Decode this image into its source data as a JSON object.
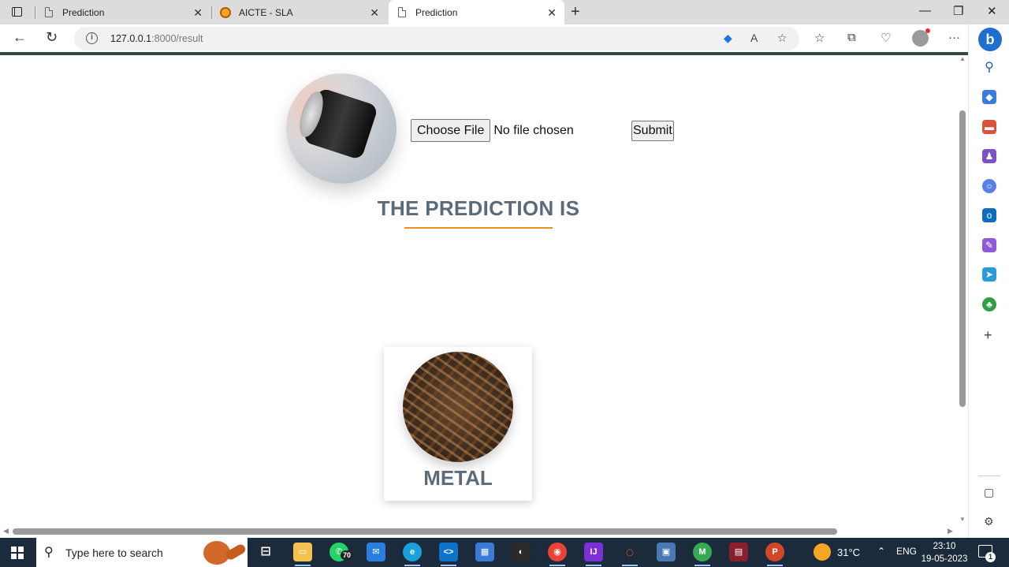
{
  "browser": {
    "tabs": [
      {
        "title": "Prediction"
      },
      {
        "title": "AICTE - SLA"
      },
      {
        "title": "Prediction"
      }
    ],
    "url_host": "127.0.0.1",
    "url_rest": ":8000/result"
  },
  "page": {
    "file_button_label": "Choose File",
    "file_status": "No file chosen",
    "submit_label": "Submit",
    "heading": "THE PREDICTION IS",
    "prediction_label": "METAL"
  },
  "colors": {
    "heading_text": "#5b6b7a",
    "heading_underline": "#f08c22",
    "divider": "#2e4a44",
    "taskbar": "#1c2b3c"
  },
  "taskbar": {
    "search_placeholder": "Type here to search",
    "whatsapp_badge": "70",
    "temperature": "31°C",
    "language": "ENG",
    "time": "23:10",
    "date": "19-05-2023",
    "notification_count": "1"
  }
}
